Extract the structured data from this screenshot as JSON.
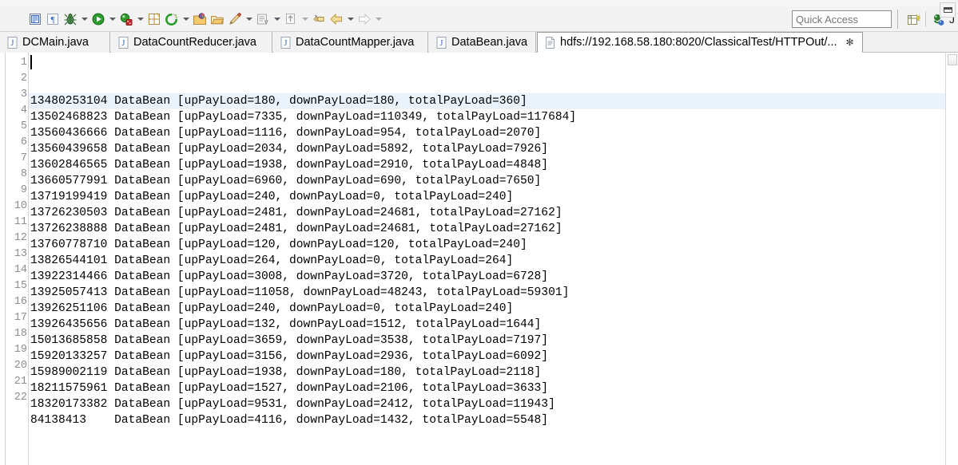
{
  "window": {
    "app": "Eclipse IDE"
  },
  "toolbar": {
    "items": [
      {
        "name": "save-icon",
        "glyph": "save",
        "arrow": false
      },
      {
        "name": "format-paragraph-icon",
        "glyph": "pilcrow",
        "arrow": false
      },
      {
        "name": "debug-icon",
        "glyph": "bug",
        "arrow": true
      },
      {
        "name": "run-icon",
        "glyph": "run",
        "arrow": true
      },
      {
        "name": "run-external-tools-icon",
        "glyph": "tools",
        "arrow": true
      },
      {
        "name": "new-java-package-icon",
        "glyph": "package",
        "arrow": false
      },
      {
        "name": "refresh-target-icon",
        "glyph": "target",
        "arrow": true
      },
      {
        "name": "open-type-icon",
        "glyph": "folder-type",
        "arrow": false
      },
      {
        "name": "open-task-icon",
        "glyph": "folder-open",
        "arrow": false
      },
      {
        "name": "pin-editor-icon",
        "glyph": "pencil",
        "arrow": true
      },
      {
        "name": "next-annotation-icon",
        "glyph": "annotation",
        "arrow": true
      },
      {
        "name": "previous-annotation-icon",
        "glyph": "annotation-prev",
        "arrow": true
      },
      {
        "name": "last-edit-location-icon",
        "glyph": "edit-location",
        "arrow": false
      },
      {
        "name": "back-icon",
        "glyph": "back-arrow",
        "arrow": true
      },
      {
        "name": "forward-icon",
        "glyph": "forward-arrow",
        "arrow": true
      }
    ]
  },
  "quick_access": {
    "placeholder": "Quick Access",
    "value": ""
  },
  "perspective": {
    "open_perspective_icon": "open-perspective-icon",
    "java_perspective_icon": "java-perspective-icon",
    "label": "J"
  },
  "tabs": [
    {
      "label": "DCMain.java",
      "icon": "java-file-icon",
      "active": false,
      "closable": false
    },
    {
      "label": "DataCountReducer.java",
      "icon": "java-file-icon",
      "active": false,
      "closable": false
    },
    {
      "label": "DataCountMapper.java",
      "icon": "java-file-icon",
      "active": false,
      "closable": false
    },
    {
      "label": "DataBean.java",
      "icon": "java-file-icon",
      "active": false,
      "closable": false
    },
    {
      "label": "hdfs://192.168.58.180:8020/ClassicalTest/HTTPOut/...",
      "icon": "text-file-icon",
      "active": true,
      "closable": true,
      "close_glyph": "✻"
    }
  ],
  "editor": {
    "line_numbers": [
      "1",
      "2",
      "3",
      "4",
      "5",
      "6",
      "7",
      "8",
      "9",
      "10",
      "11",
      "12",
      "13",
      "14",
      "15",
      "16",
      "17",
      "18",
      "19",
      "20",
      "21",
      "22"
    ],
    "current_line": 1,
    "lines": [
      "13480253104 DataBean [upPayLoad=180, downPayLoad=180, totalPayLoad=360]",
      "13502468823 DataBean [upPayLoad=7335, downPayLoad=110349, totalPayLoad=117684]",
      "13560436666 DataBean [upPayLoad=1116, downPayLoad=954, totalPayLoad=2070]",
      "13560439658 DataBean [upPayLoad=2034, downPayLoad=5892, totalPayLoad=7926]",
      "13602846565 DataBean [upPayLoad=1938, downPayLoad=2910, totalPayLoad=4848]",
      "13660577991 DataBean [upPayLoad=6960, downPayLoad=690, totalPayLoad=7650]",
      "13719199419 DataBean [upPayLoad=240, downPayLoad=0, totalPayLoad=240]",
      "13726230503 DataBean [upPayLoad=2481, downPayLoad=24681, totalPayLoad=27162]",
      "13726238888 DataBean [upPayLoad=2481, downPayLoad=24681, totalPayLoad=27162]",
      "13760778710 DataBean [upPayLoad=120, downPayLoad=120, totalPayLoad=240]",
      "13826544101 DataBean [upPayLoad=264, downPayLoad=0, totalPayLoad=264]",
      "13922314466 DataBean [upPayLoad=3008, downPayLoad=3720, totalPayLoad=6728]",
      "13925057413 DataBean [upPayLoad=11058, downPayLoad=48243, totalPayLoad=59301]",
      "13926251106 DataBean [upPayLoad=240, downPayLoad=0, totalPayLoad=240]",
      "13926435656 DataBean [upPayLoad=132, downPayLoad=1512, totalPayLoad=1644]",
      "15013685858 DataBean [upPayLoad=3659, downPayLoad=3538, totalPayLoad=7197]",
      "15920133257 DataBean [upPayLoad=3156, downPayLoad=2936, totalPayLoad=6092]",
      "15989002119 DataBean [upPayLoad=1938, downPayLoad=180, totalPayLoad=2118]",
      "18211575961 DataBean [upPayLoad=1527, downPayLoad=2106, totalPayLoad=3633]",
      "18320173382 DataBean [upPayLoad=9531, downPayLoad=2412, totalPayLoad=11943]",
      "84138413    DataBean [upPayLoad=4116, downPayLoad=1432, totalPayLoad=5548]",
      ""
    ]
  },
  "colors": {
    "toolbar_bg": "#f3f3f3",
    "tab_bg": "#f2f2f2",
    "active_tab_bg": "#ffffff",
    "current_line_highlight": "#eaf2fb",
    "gutter_text": "#8d8d8d",
    "code_text": "#000000"
  }
}
